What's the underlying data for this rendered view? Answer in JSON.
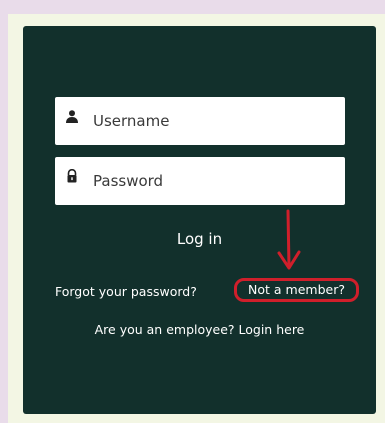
{
  "login": {
    "username_placeholder": "Username",
    "password_placeholder": "Password",
    "login_label": "Log in",
    "forgot_label": "Forgot your password?",
    "member_label": "Not a member?",
    "employee_label": "Are you an employee? Login here"
  },
  "icons": {
    "username": "user-icon",
    "password": "lock-icon",
    "annotation": "arrow-down-icon"
  },
  "colors": {
    "card_background": "#12302c",
    "page_background": "#f3f6e4",
    "outer_background": "#e9dcea",
    "annotation": "#d01f2b",
    "text": "#ffffff"
  }
}
